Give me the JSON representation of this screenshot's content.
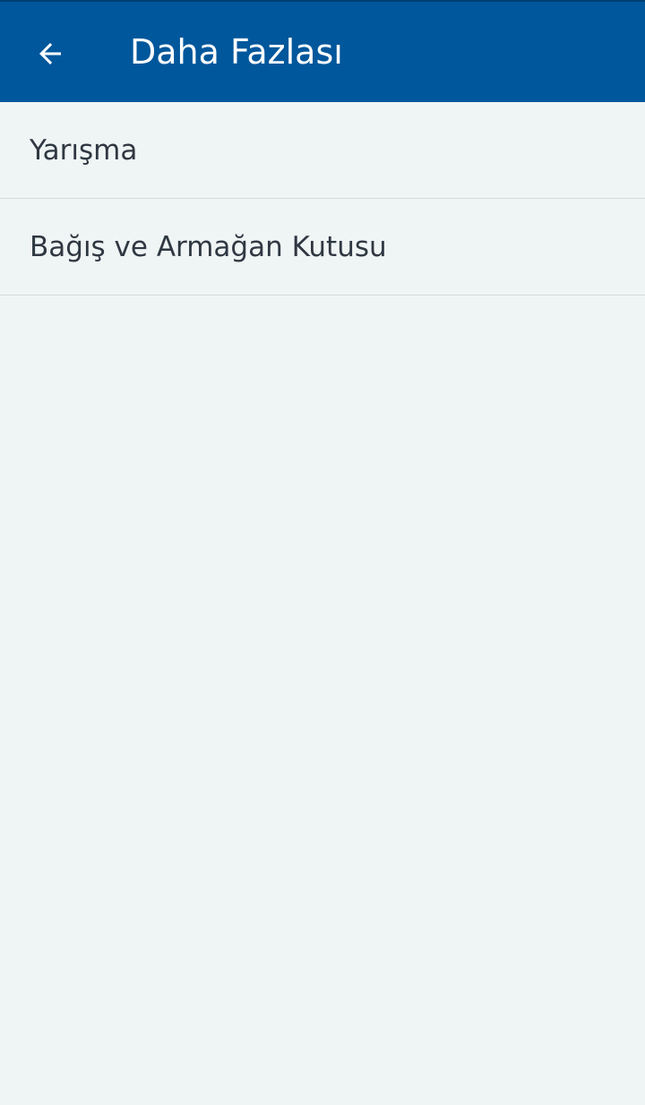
{
  "header": {
    "title": "Daha Fazlası",
    "back_icon": "arrow-back-icon",
    "background_color": "#00579b"
  },
  "menu": {
    "items": [
      {
        "label": "Yarışma"
      },
      {
        "label": "Bağış ve Armağan Kutusu"
      }
    ]
  }
}
